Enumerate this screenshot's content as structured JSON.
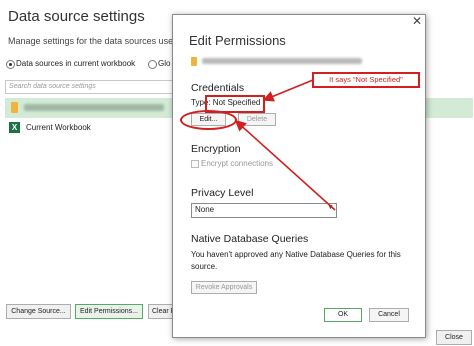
{
  "background_window": {
    "title": "Data source settings",
    "description": "Manage settings for the data sources used in",
    "radio_current": "Data sources in current workbook",
    "radio_global": "Glo",
    "search_placeholder": "Search data source settings",
    "list_items": [
      {
        "label": "",
        "icon": "database-icon",
        "selected": true
      },
      {
        "label": "Current Workbook",
        "icon": "excel-icon",
        "selected": false
      }
    ],
    "buttons": {
      "change_source": "Change Source...",
      "edit_permissions": "Edit Permissions...",
      "clear": "Clear P",
      "close": "Close"
    }
  },
  "dialog": {
    "title": "Edit Permissions",
    "close_glyph": "✕",
    "credentials": {
      "heading": "Credentials",
      "type_text": "Type: Not Specified",
      "edit_label": "Edit...",
      "delete_label": "Delete"
    },
    "encryption": {
      "heading": "Encryption",
      "checkbox_label": "Encrypt connections"
    },
    "privacy": {
      "heading": "Privacy Level",
      "selected": "None"
    },
    "native_queries": {
      "heading": "Native Database Queries",
      "text": "You haven't approved any Native Database Queries for this source.",
      "revoke_label": "Revoke Approvals"
    },
    "ok_label": "OK",
    "cancel_label": "Cancel"
  },
  "annotation": {
    "callout_text": "It says \"Not Specified\"",
    "color": "#d21f1f"
  },
  "colors": {
    "selected_row": "#d2ead6",
    "accent_green": "#5aa865"
  }
}
